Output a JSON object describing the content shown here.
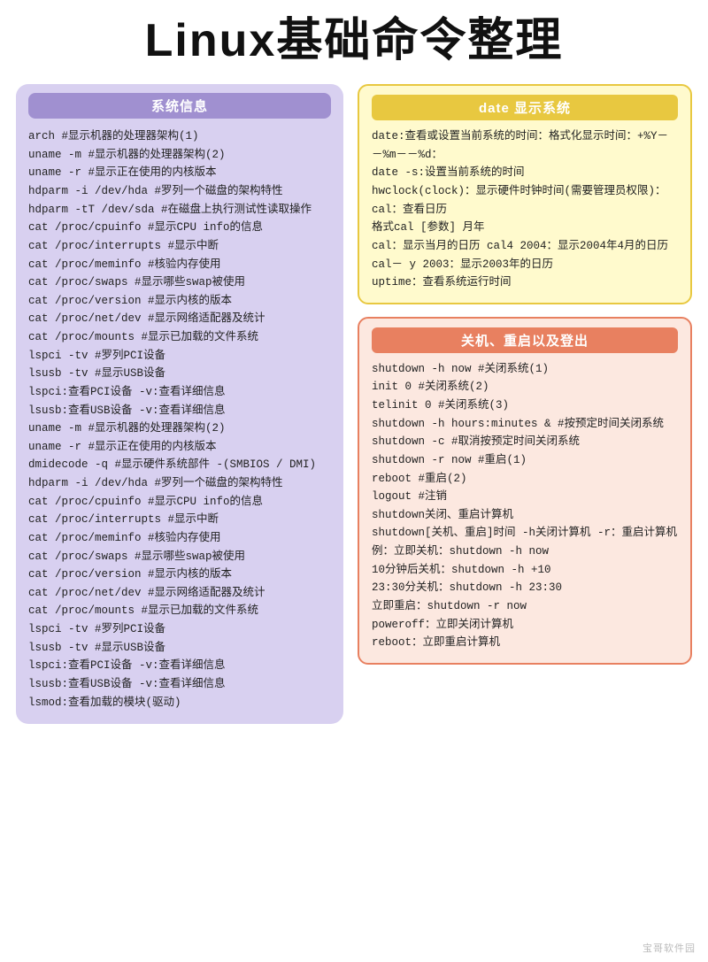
{
  "title": "Linux基础命令整理",
  "left": {
    "header": "系统信息",
    "lines": [
      "arch      #显示机器的处理器架构(1)",
      "uname -m  #显示机器的处理器架构(2)",
      "uname -r  #显示正在使用的内核版本",
      "hdparm -i /dev/hda   #罗列一个磁盘的架构特性",
      "hdparm -tT /dev/sda  #在磁盘上执行测试性读取操作",
      "cat /proc/cpuinfo     #显示CPU info的信息",
      "cat /proc/interrupts  #显示中断",
      "cat /proc/meminfo     #核验内存使用",
      "cat /proc/swaps       #显示哪些swap被使用",
      "cat /proc/version     #显示内核的版本",
      "cat /proc/net/dev     #显示网络适配器及统计",
      "cat /proc/mounts      #显示已加载的文件系统",
      "lspci -tv   #罗列PCI设备",
      "lsusb -tv   #显示USB设备",
      "lspci:查看PCI设备  -v:查看详细信息",
      "lsusb:查看USB设备  -v:查看详细信息",
      "uname -m  #显示机器的处理器架构(2)",
      "uname -r  #显示正在使用的内核版本",
      "dmidecode -q       #显示硬件系统部件 -(SMBIOS / DMI)",
      "hdparm -i /dev/hda   #罗列一个磁盘的架构特性",
      "cat /proc/cpuinfo     #显示CPU info的信息",
      "cat /proc/interrupts  #显示中断",
      "cat /proc/meminfo     #核验内存使用",
      "cat /proc/swaps       #显示哪些swap被使用",
      "cat /proc/version     #显示内核的版本",
      "cat /proc/net/dev     #显示网络适配器及统计",
      "cat /proc/mounts      #显示已加载的文件系统",
      "lspci -tv   #罗列PCI设备",
      "lsusb -tv   #显示USB设备",
      "lspci:查看PCI设备  -v:查看详细信息",
      "lsusb:查看USB设备  -v:查看详细信息",
      "lsmod:查看加载的模块(驱动)"
    ]
  },
  "date": {
    "header": "date 显示系统",
    "lines": [
      "date:查看或设置当前系统的时间：格式化显示时间：+%Y－－%m－－%d：",
      "date -s:设置当前系统的时间",
      "hwclock(clock)：显示硬件时钟时间(需要管理员权限)：",
      "cal：查看日历",
      "格式cal [参数] 月年",
      "cal：显示当月的日历   cal4 2004：显示2004年4月的日历",
      "cal－ y 2003：显示2003年的日历",
      "uptime：查看系统运行时间"
    ]
  },
  "shutdown": {
    "header": "关机、重启以及登出",
    "lines": [
      "shutdown -h now   #关闭系统(1)",
      "init 0            #关闭系统(2)",
      "telinit 0         #关闭系统(3)",
      "shutdown -h hours:minutes &  #按预定时间关闭系统",
      "shutdown -c       #取消按预定时间关闭系统",
      "shutdown -r now   #重启(1)",
      "reboot   #重启(2)",
      "logout   #注销",
      "shutdown关闭、重启计算机",
      "shutdown[关机、重启]时间  -h关闭计算机  -r：重启计算机",
      "例：立即关机：shutdown -h now",
      "10分钟后关机：shutdown -h +10",
      "23:30分关机：shutdown -h 23:30",
      "立即重启：shutdown -r now",
      "poweroff：立即关闭计算机",
      "reboot：立即重启计算机"
    ]
  },
  "watermark": "宝哥软件园"
}
